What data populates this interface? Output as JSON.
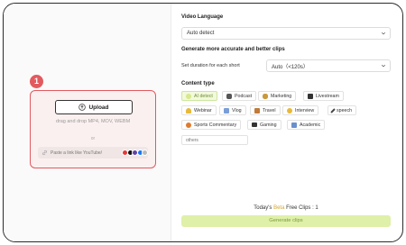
{
  "upload_panel": {
    "step_number": "1",
    "upload_label": "Upload",
    "drag_text": "drag and drop MP4, MOV, WEBM",
    "or_text": "or",
    "link_placeholder": "Paste a link like YouTube/",
    "source_icons": [
      "youtube",
      "tiktok",
      "twitch",
      "facebook",
      "more"
    ]
  },
  "settings": {
    "video_language_label": "Video Language",
    "video_language_value": "Auto detect",
    "clips_heading": "Generate more accurate and better clips",
    "duration_label": "Set duration for each short",
    "duration_value": "Auto（<120s）",
    "content_type_label": "Content type",
    "content_types": [
      {
        "label": "AI detect",
        "icon": "sparkle-icon",
        "active": true
      },
      {
        "label": "Podcast",
        "icon": "microphone-icon",
        "active": false
      },
      {
        "label": "Marketing",
        "icon": "money-bag-icon",
        "active": false
      },
      {
        "label": "Livestream",
        "icon": "tv-icon",
        "active": false
      },
      {
        "label": "Webinar",
        "icon": "bell-icon",
        "active": false
      },
      {
        "label": "Vlog",
        "icon": "camera-icon",
        "active": false
      },
      {
        "label": "Travel",
        "icon": "luggage-icon",
        "active": false
      },
      {
        "label": "Interview",
        "icon": "person-icon",
        "active": false
      },
      {
        "label": "speech",
        "icon": "pen-icon",
        "active": false
      },
      {
        "label": "Sports Commentary",
        "icon": "basketball-icon",
        "active": false
      },
      {
        "label": "Gaming",
        "icon": "flag-icon",
        "active": false
      },
      {
        "label": "Academic",
        "icon": "book-icon",
        "active": false
      }
    ],
    "others_placeholder": "others"
  },
  "footer": {
    "free_clips_prefix": "Today's ",
    "free_clips_highlight": "Beta",
    "free_clips_suffix": " Free Clips : 1",
    "generate_label": "Generate clips"
  }
}
